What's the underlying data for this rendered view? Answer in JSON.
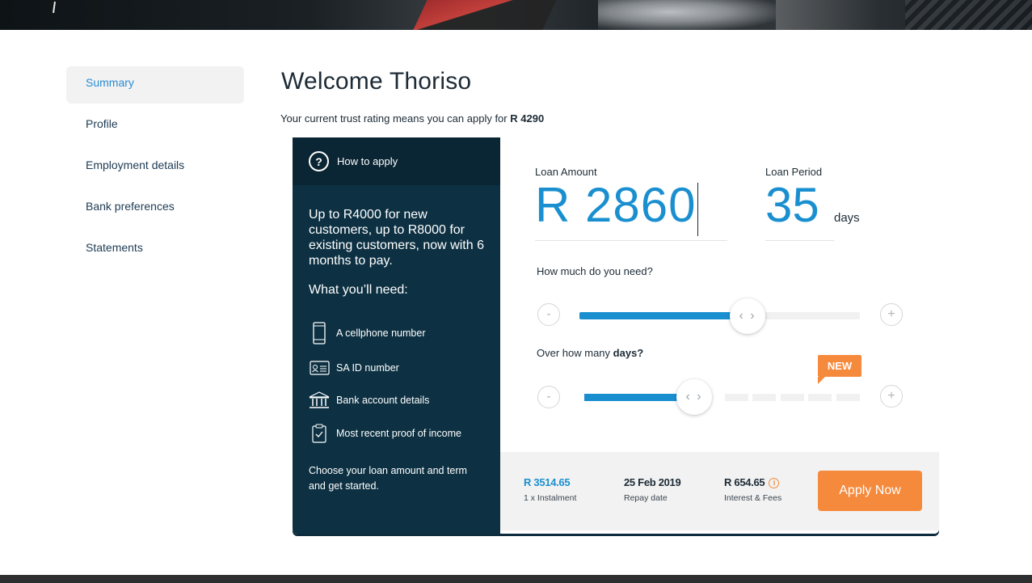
{
  "colors": {
    "accent": "#1a8fd0",
    "orange": "#f58a3c",
    "navy": "#0d3143"
  },
  "sidebar": {
    "items": [
      {
        "label": "Summary",
        "active": true
      },
      {
        "label": "Profile"
      },
      {
        "label": "Employment details"
      },
      {
        "label": "Bank preferences"
      },
      {
        "label": "Statements"
      }
    ]
  },
  "header": {
    "title": "Welcome Thoriso",
    "subtitle_prefix": "Your current trust rating means you can apply for",
    "subtitle_amount": "R 4290"
  },
  "info_panel": {
    "how_to_apply": "How to apply",
    "promo": "Up to R4000 for new customers, up to R8000 for existing customers, now with 6 months to pay.",
    "need_title": "What you’ll need:",
    "requirements": [
      {
        "icon": "cellphone-icon",
        "label": "A cellphone number"
      },
      {
        "icon": "id-card-icon",
        "label": "SA ID number"
      },
      {
        "icon": "bank-icon",
        "label": "Bank account details"
      },
      {
        "icon": "clipboard-icon",
        "label": "Most recent proof of income"
      }
    ],
    "choose": "Choose your loan amount and term and get started."
  },
  "calculator": {
    "loan_amount_label": "Loan Amount",
    "loan_amount": "R 2860",
    "loan_period_label": "Loan Period",
    "loan_period": "35",
    "period_unit": "days",
    "amount_question": "How much do you need?",
    "days_question_prefix": "Over how many",
    "days_question_bold": "days?",
    "minus": "-",
    "plus": "+",
    "thumb_glyph": "‹ ›",
    "new_badge": "NEW",
    "amount_slider_fraction": 0.6,
    "days_slider_fraction": 0.4
  },
  "summary": {
    "instalment_value": "R 3514.65",
    "instalment_label": "1 x Instalment",
    "repay_date_value": "25 Feb 2019",
    "repay_date_label": "Repay date",
    "fees_value": "R 654.65",
    "fees_label": "Interest & Fees",
    "info_glyph": "i",
    "apply_label": "Apply Now"
  }
}
